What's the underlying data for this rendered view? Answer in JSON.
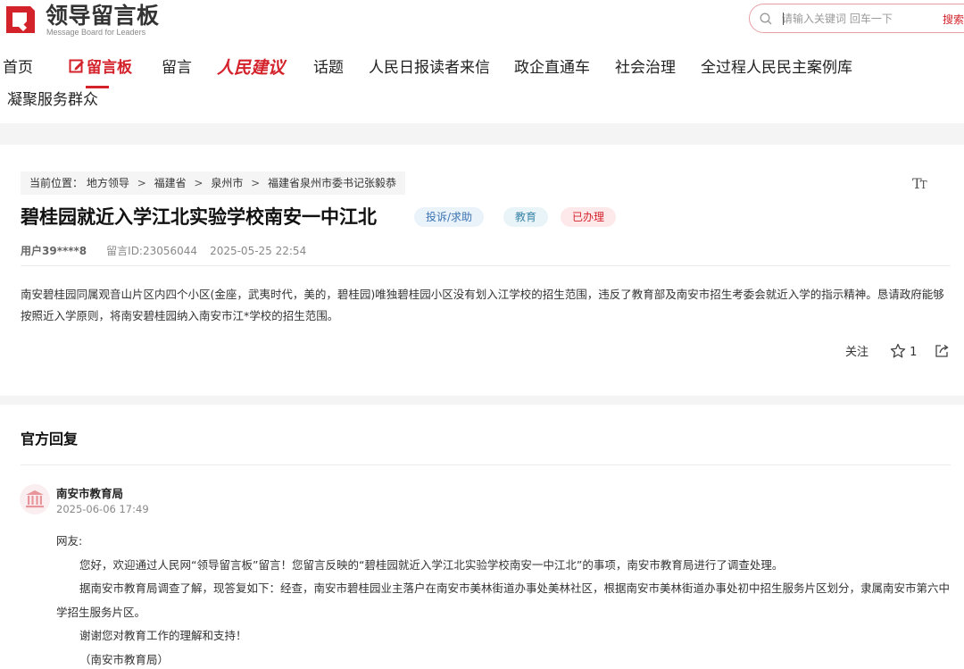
{
  "header": {
    "logo_title": "领导留言板",
    "logo_subtitle": "Message Board for Leaders",
    "search_placeholder": "请输入关键词 回车一下",
    "search_button": "搜索"
  },
  "nav": {
    "items": [
      "首页",
      "留言板",
      "留言",
      "人民建议",
      "话题",
      "人民日报读者来信",
      "政企直通车",
      "社会治理",
      "全过程人民民主案例库"
    ],
    "row2": "凝聚服务群众",
    "active": "留言板"
  },
  "breadcrumb": {
    "prefix": "当前位置：",
    "items": [
      "地方领导",
      "福建省",
      "泉州市",
      "福建省泉州市委书记张毅恭"
    ]
  },
  "font_size_icon": "text-size-icon",
  "message": {
    "title": "碧桂园就近入学江北实验学校南安一中江北",
    "tags": {
      "type": "投诉/求助",
      "field": "教育",
      "status": "已办理"
    },
    "user": "用户39****8",
    "message_id": "留言ID:23056044",
    "datetime": "2025-05-25 22:54",
    "content": "南安碧桂园同属观音山片区内四个小区(金座，武夷时代，美的，碧桂园)唯独碧桂园小区没有划入江学校的招生范围，违反了教育部及南安市招生考委会就近入学的指示精神。恳请政府能够按照近入学原则，将南安碧桂园纳入南安市江*学校的招生范围。",
    "follow_label": "关注",
    "star_count": "1"
  },
  "reply": {
    "section_title": "官方回复",
    "org": "南安市教育局",
    "datetime": "2025-06-06 17:49",
    "greeting": "网友:",
    "paragraphs": [
      "您好，欢迎通过人民网“领导留言板”留言！您留言反映的“碧桂园就近入学江北实验学校南安一中江北”的事项，南安市教育局进行了调查处理。",
      "据南安市教育局调查了解，现答复如下：经查，南安市碧桂园业主落户在南安市美林街道办事处美林社区，根据南安市美林街道办事处初中招生服务片区划分，隶属南安市第六中学招生服务片区。",
      "谢谢您对教育工作的理解和支持！",
      "（南安市教育局）"
    ]
  },
  "colors": {
    "brand_red": "#d4222b",
    "tag_blue": "#3a73b3",
    "band_gray": "#f4f4f4"
  }
}
